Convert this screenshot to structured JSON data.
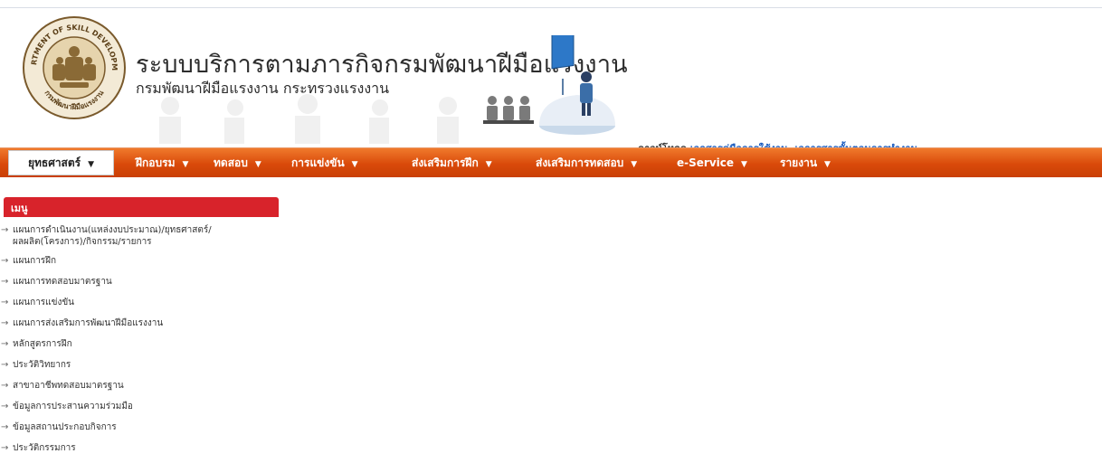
{
  "header": {
    "title": "ระบบบริการตามภารกิจกรมพัฒนาฝีมือแรงงาน",
    "subtitle": "กรมพัฒนาฝีมือแรงงาน กระทรวงแรงงาน",
    "seal": {
      "top_text": "DEPARTMENT OF SKILL DEVELOPMENT",
      "bottom_text": "กรมพัฒนาฝีมือแรงงาน"
    },
    "download_label": "ดาวน์โหลด",
    "download_link_1": "เอกสารคู่มือการใช้งาน",
    "download_separator": ",",
    "download_link_2": "เอการสารขั้นตอนการทำงาน"
  },
  "nav": {
    "items": [
      {
        "label": "ยุทธศาสตร์",
        "icon": "caret-down-icon"
      },
      {
        "label": "ฝึกอบรม",
        "icon": "caret-down-icon"
      },
      {
        "label": "ทดสอบ",
        "icon": "caret-down-icon"
      },
      {
        "label": "การแข่งขัน",
        "icon": "caret-down-icon"
      },
      {
        "label": "ส่งเสริมการฝึก",
        "icon": "caret-down-icon"
      },
      {
        "label": "ส่งเสริมการทดสอบ",
        "icon": "caret-down-icon"
      },
      {
        "label": "e-Service",
        "icon": "caret-down-icon"
      },
      {
        "label": "รายงาน",
        "icon": "caret-down-icon"
      }
    ],
    "active_index": 0
  },
  "menu": {
    "title": "เมนู",
    "items": [
      {
        "label": "แผนการดำเนินงาน(แหล่งงบประมาณ)/ยุทธศาสตร์/ผลผลิต(โครงการ)/กิจกรรม/รายการ"
      },
      {
        "label": "แผนการฝึก"
      },
      {
        "label": "แผนการทดสอบมาตรฐาน"
      },
      {
        "label": "แผนการแข่งขัน"
      },
      {
        "label": "แผนการส่งเสริมการพัฒนาฝีมือแรงงาน"
      },
      {
        "label": "หลักสูตรการฝึก"
      },
      {
        "label": "ประวัติวิทยากร"
      },
      {
        "label": "สาขาอาชีพทดสอบมาตรฐาน"
      },
      {
        "label": "ข้อมูลการประสานความร่วมมือ"
      },
      {
        "label": "ข้อมูลสถานประกอบกิจการ"
      },
      {
        "label": "ประวัติกรรมการ"
      }
    ]
  },
  "colors": {
    "nav": "#d94a0a",
    "menu_header": "#d8232b",
    "link": "#1f5fbf"
  }
}
